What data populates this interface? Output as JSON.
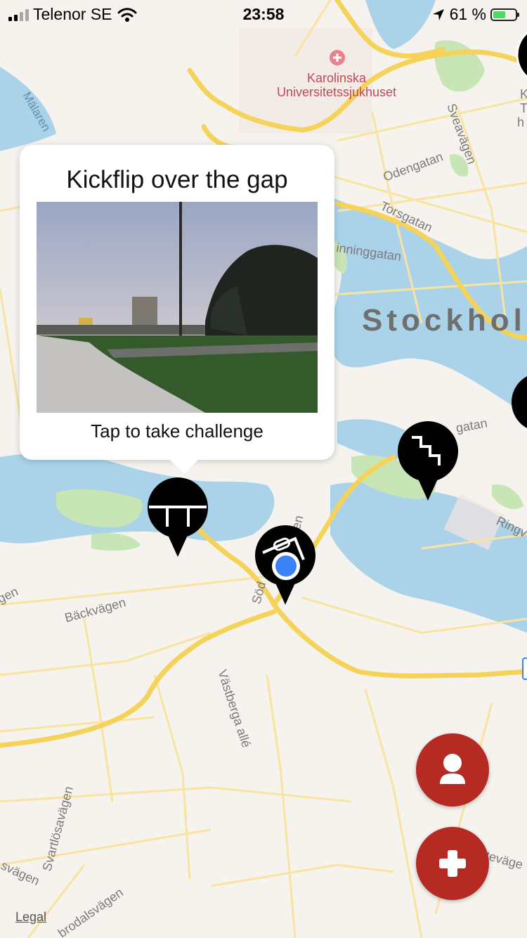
{
  "status_bar": {
    "carrier": "Telenor SE",
    "time": "23:58",
    "battery_percent": "61 %",
    "battery_level": 0.61
  },
  "map": {
    "labels": {
      "hospital": [
        "Karolinska",
        "Universitetssjukhuset"
      ],
      "city": "Stockhol",
      "malaren": "Mälaren",
      "odengatan": "Odengatan",
      "torsgatan": "Torsgatan",
      "sveavagen": "Sveavägen",
      "inninggatan": "inninggatan",
      "gatan": "gatan",
      "ringv": "Ringv",
      "soder": "Söd",
      "ren": "ren",
      "backvagen": "Bäckvägen",
      "gen": "gen",
      "vastberga": "Västberga allé",
      "svartlosavagen": "Svartlösavägen",
      "svagen": "svägen",
      "brodalsvagen": "brodalsvägen",
      "tevage": "teväge",
      "edge_k": "K",
      "edge_t": "T",
      "edge_h": "h"
    },
    "legal": "Legal"
  },
  "popup": {
    "title": "Kickflip over the gap",
    "subtitle": "Tap to take challenge"
  },
  "pins": [
    {
      "name": "gap",
      "icon": "gap-icon"
    },
    {
      "name": "stairs",
      "icon": "stairs-icon"
    },
    {
      "name": "rail",
      "icon": "rail-icon"
    },
    {
      "name": "offscreen-right",
      "icon": "spot-icon"
    },
    {
      "name": "offscreen-top-right",
      "icon": "spot-icon"
    }
  ],
  "buttons": {
    "profile_icon": "person-icon",
    "add_icon": "plus-icon"
  },
  "colors": {
    "map_bg": "#f6f3ee",
    "water": "#aad3ea",
    "park": "#c7e5b5",
    "road_major": "#f5d35a",
    "road_minor": "#f8e3a0",
    "fab": "#b52a23",
    "user_location": "#3b82f6",
    "hospital_label": "#c0495a"
  }
}
